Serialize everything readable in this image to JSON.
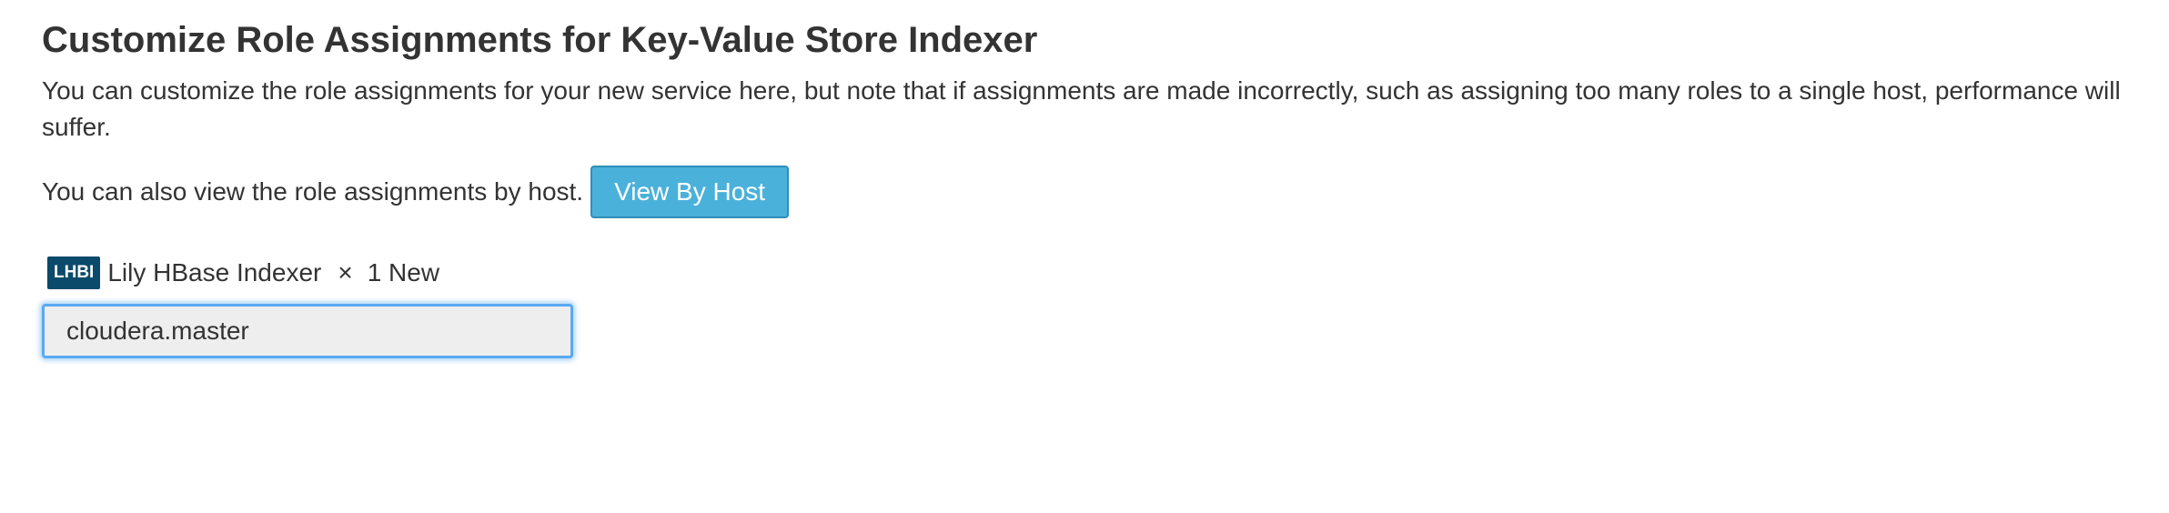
{
  "page": {
    "title": "Customize Role Assignments for Key-Value Store Indexer",
    "description": "You can customize the role assignments for your new service here, but note that if assignments are made incorrectly, such as assigning too many roles to a single host, performance will suffer.",
    "by_host_text": "You can also view the role assignments by host.",
    "view_by_host_label": "View By Host"
  },
  "role": {
    "badge": "LHBI",
    "name": "Lily HBase Indexer",
    "times_symbol": "×",
    "count_label": "1 New",
    "assigned_host": "cloudera.master"
  },
  "colors": {
    "button_bg": "#4ab1da",
    "badge_bg": "#0b4a6a",
    "focus_ring": "#5aa9f0"
  }
}
